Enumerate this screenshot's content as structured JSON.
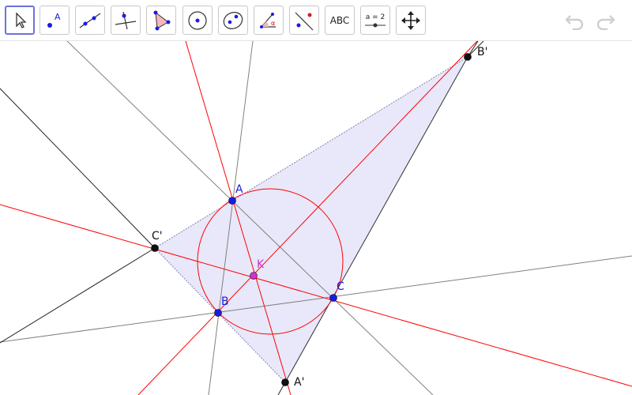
{
  "toolbar": {
    "tools": [
      {
        "name": "move-tool",
        "active": true
      },
      {
        "name": "point-tool"
      },
      {
        "name": "line-tool"
      },
      {
        "name": "perpendicular-line-tool"
      },
      {
        "name": "polygon-tool"
      },
      {
        "name": "circle-center-point-tool"
      },
      {
        "name": "conic-five-points-tool"
      },
      {
        "name": "angle-tool"
      },
      {
        "name": "reflect-about-line-tool"
      },
      {
        "name": "text-tool",
        "label": "ABC"
      },
      {
        "name": "slider-tool",
        "label": "a = 2"
      },
      {
        "name": "move-graphics-view-tool"
      }
    ],
    "undo_icon": "undo-icon",
    "redo_icon": "redo-icon"
  },
  "points": {
    "A": {
      "label": "A"
    },
    "B": {
      "label": "B"
    },
    "C": {
      "label": "C"
    },
    "K": {
      "label": "K"
    },
    "A1": {
      "label": "A'"
    },
    "B1": {
      "label": "B'"
    },
    "C1": {
      "label": "C'"
    }
  },
  "colors": {
    "blue_point": "#1a1ae6",
    "black_point": "#111111",
    "magenta_point": "#cc33cc",
    "red_line": "#ff0000",
    "gray_line": "#808080",
    "triangle_fill": "#e8e8fa",
    "active_tool_border": "#6b74d8"
  }
}
